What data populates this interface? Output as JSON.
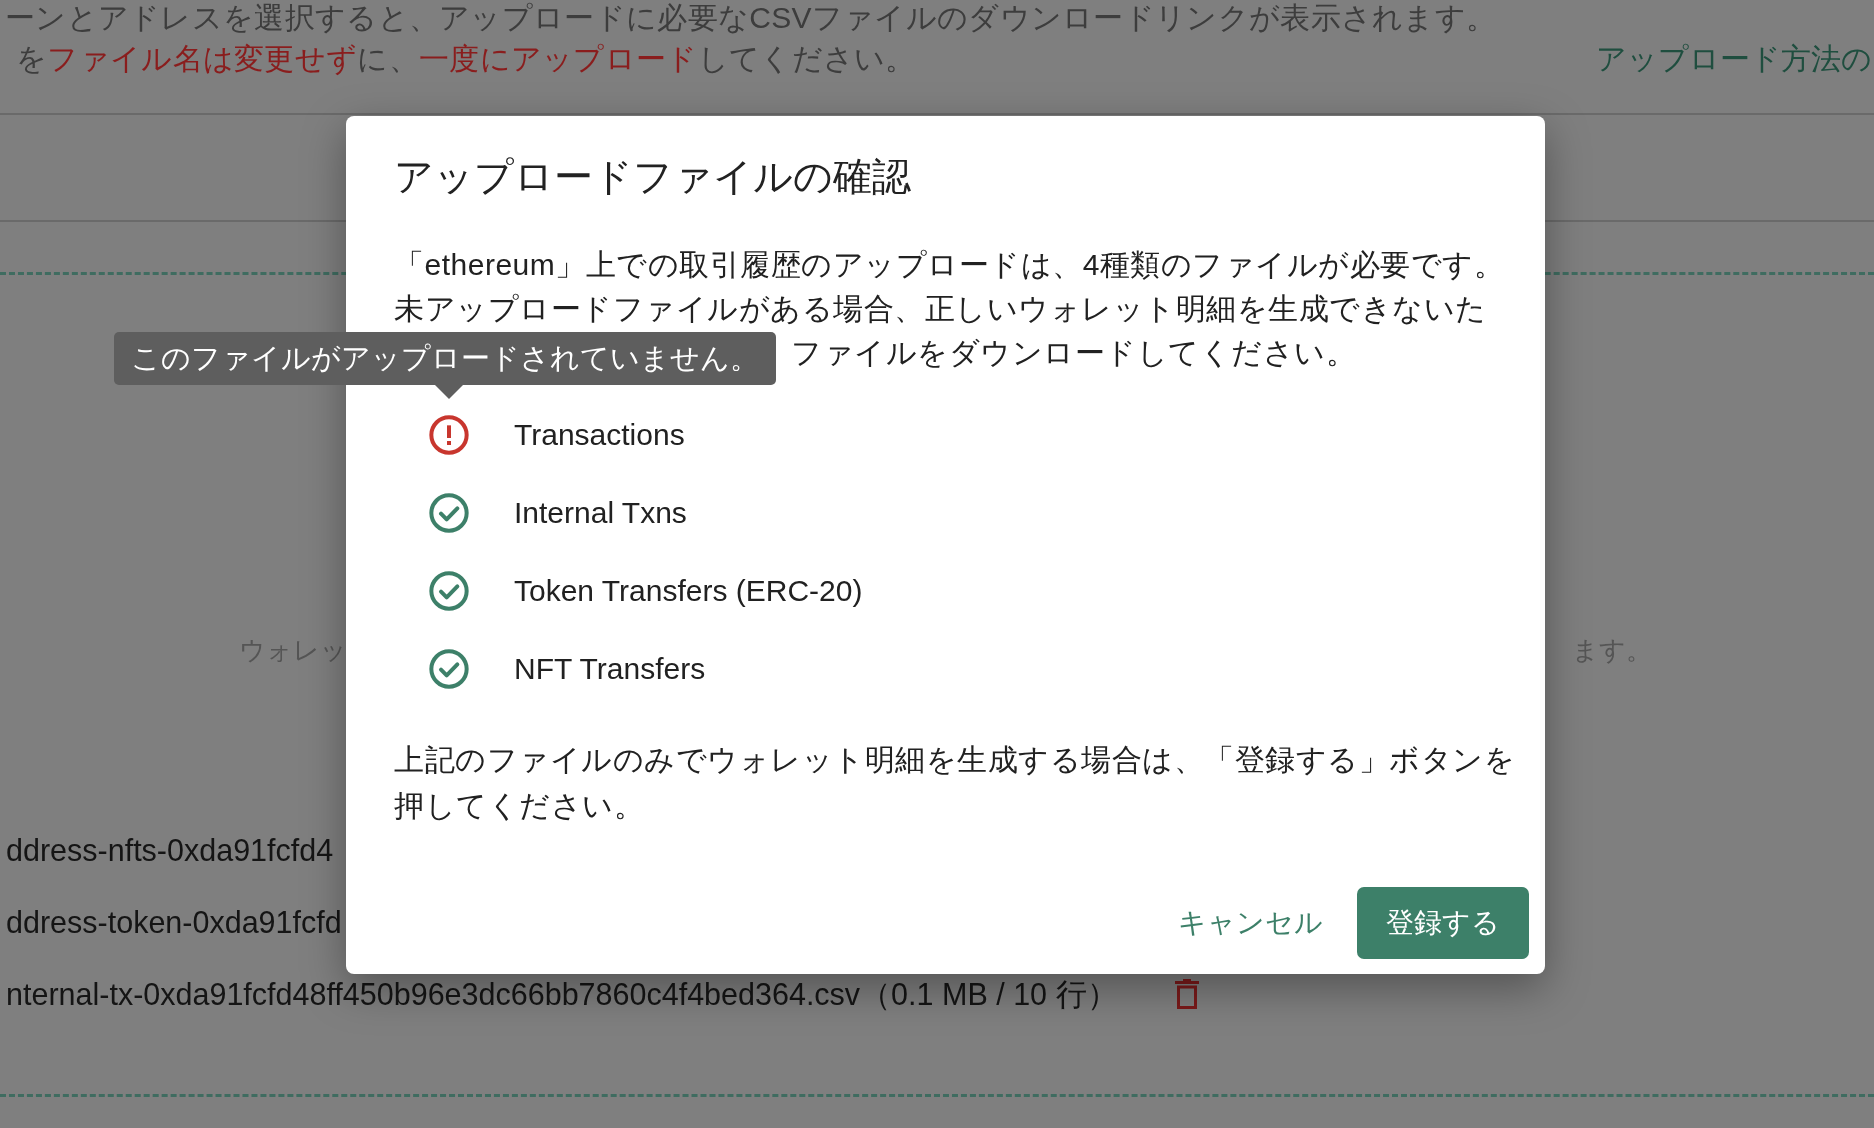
{
  "page": {
    "instructions": [
      {
        "segments": [
          {
            "text": "ーンとアドレスを選択すると、アップロードに必要なCSVファイルのダウンロードリンクが表示されます。",
            "emphasis": false
          }
        ]
      },
      {
        "segments": [
          {
            "text": "を",
            "emphasis": false
          },
          {
            "text": "ファイル名は変更せず",
            "emphasis": true
          },
          {
            "text": "に、",
            "emphasis": false
          },
          {
            "text": "一度にアップロード",
            "emphasis": true
          },
          {
            "text": "してください。",
            "emphasis": false
          }
        ]
      }
    ],
    "help_link": "アップロード方法の",
    "drop_zone": {
      "notice_visible_start": "ウォレッ",
      "notice_visible_end": "ます。",
      "files": [
        {
          "label": "ddress-nfts-0xda91fcfd4",
          "trash_icon": false
        },
        {
          "label": "ddress-token-0xda91fcfd",
          "trash_icon": false
        },
        {
          "label": "nternal-tx-0xda91fcfd48ff450b96e3dc66bb7860c4f4bed364.csv（0.1 MB / 10 行）",
          "trash_icon": true
        }
      ]
    }
  },
  "dialog": {
    "title": "アップロードファイルの確認",
    "message": "「ethereum」上での取引履歴のアップロードは、4種類のファイルが必要です。未アップロードファイルがある場合、正しいウォレット明細を生成できないた",
    "message_visible_end": "ファイルをダウンロードしてください。",
    "files": [
      {
        "name": "Transactions",
        "uploaded": false
      },
      {
        "name": "Internal Txns",
        "uploaded": true
      },
      {
        "name": "Token Transfers (ERC-20)",
        "uploaded": true
      },
      {
        "name": "NFT Transfers",
        "uploaded": true
      }
    ],
    "note": "上記のファイルのみでウォレット明細を生成する場合は、「登録する」ボタンを押してください。",
    "buttons": [
      {
        "label": "キャンセル",
        "kind": "text"
      },
      {
        "label": "登録する",
        "kind": "primary"
      }
    ]
  },
  "tooltip": {
    "text": "このファイルがアップロードされていません。"
  }
}
